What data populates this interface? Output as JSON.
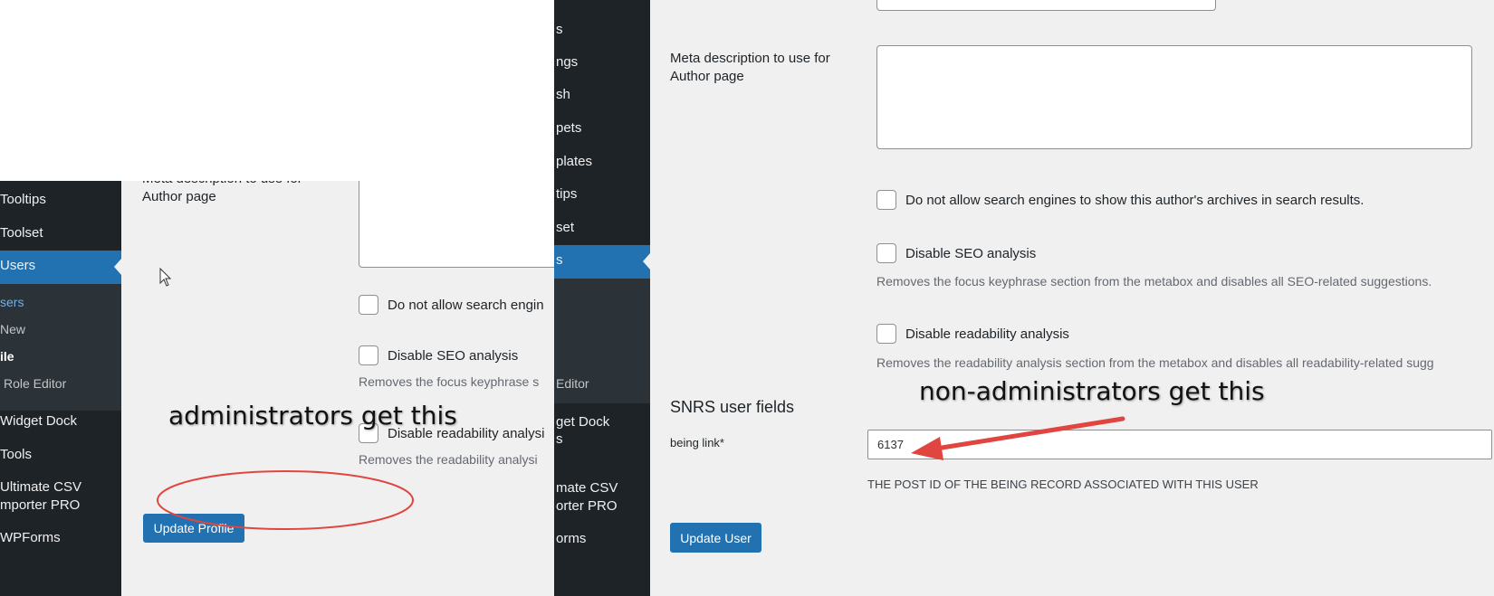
{
  "left": {
    "sidebar": {
      "items": [
        {
          "label": "Tooltips"
        },
        {
          "label": "Toolset"
        },
        {
          "label": "Users"
        },
        {
          "label": "sers"
        },
        {
          "label": "New"
        },
        {
          "label": "ile"
        },
        {
          "label": "Role Editor"
        },
        {
          "label": "Widget Dock"
        },
        {
          "label": "Tools"
        },
        {
          "label": "Ultimate CSV"
        },
        {
          "label": "mporter PRO"
        },
        {
          "label": "WPForms"
        }
      ]
    },
    "form": {
      "meta_label_partial": "Meta description to use for",
      "meta_label_line2": "Author page",
      "noindex_label": "Do not allow search engin",
      "seo_label": "Disable SEO analysis",
      "seo_help": "Removes the focus keyphrase s",
      "readability_label": "Disable readability analysi",
      "readability_help": "Removes the readability analysi"
    },
    "update_button": "Update Profile",
    "annotation": "administrators get this",
    "colors": {
      "highlight_oval": "#e0453f",
      "button": "#2271b1"
    }
  },
  "right": {
    "sidebar": {
      "items": [
        {
          "label": "s"
        },
        {
          "label": "ngs"
        },
        {
          "label": "sh"
        },
        {
          "label": "pets"
        },
        {
          "label": "plates"
        },
        {
          "label": "tips"
        },
        {
          "label": "set"
        },
        {
          "label": "s"
        },
        {
          "label": "Editor"
        },
        {
          "label": "get Dock"
        },
        {
          "label": "s"
        },
        {
          "label": "mate CSV"
        },
        {
          "label": "orter PRO"
        },
        {
          "label": "orms"
        }
      ]
    },
    "form": {
      "meta_label": "Meta description to use for",
      "meta_label_line2": "Author page",
      "noindex_label": "Do not allow search engines to show this author's archives in search results.",
      "seo_label": "Disable SEO analysis",
      "seo_help": "Removes the focus keyphrase section from the metabox and disables all SEO-related suggestions.",
      "readability_label": "Disable readability analysis",
      "readability_help": "Removes the readability analysis section from the metabox and disables all readability-related sugg"
    },
    "section_title": "SNRS user fields",
    "being_link": {
      "label": "being link*",
      "value": "6137",
      "help": "THE POST ID OF THE BEING RECORD ASSOCIATED WITH THIS USER"
    },
    "update_button": "Update User",
    "annotation": "non-administrators get this",
    "colors": {
      "arrow": "#e0453f",
      "button": "#2271b1"
    }
  }
}
